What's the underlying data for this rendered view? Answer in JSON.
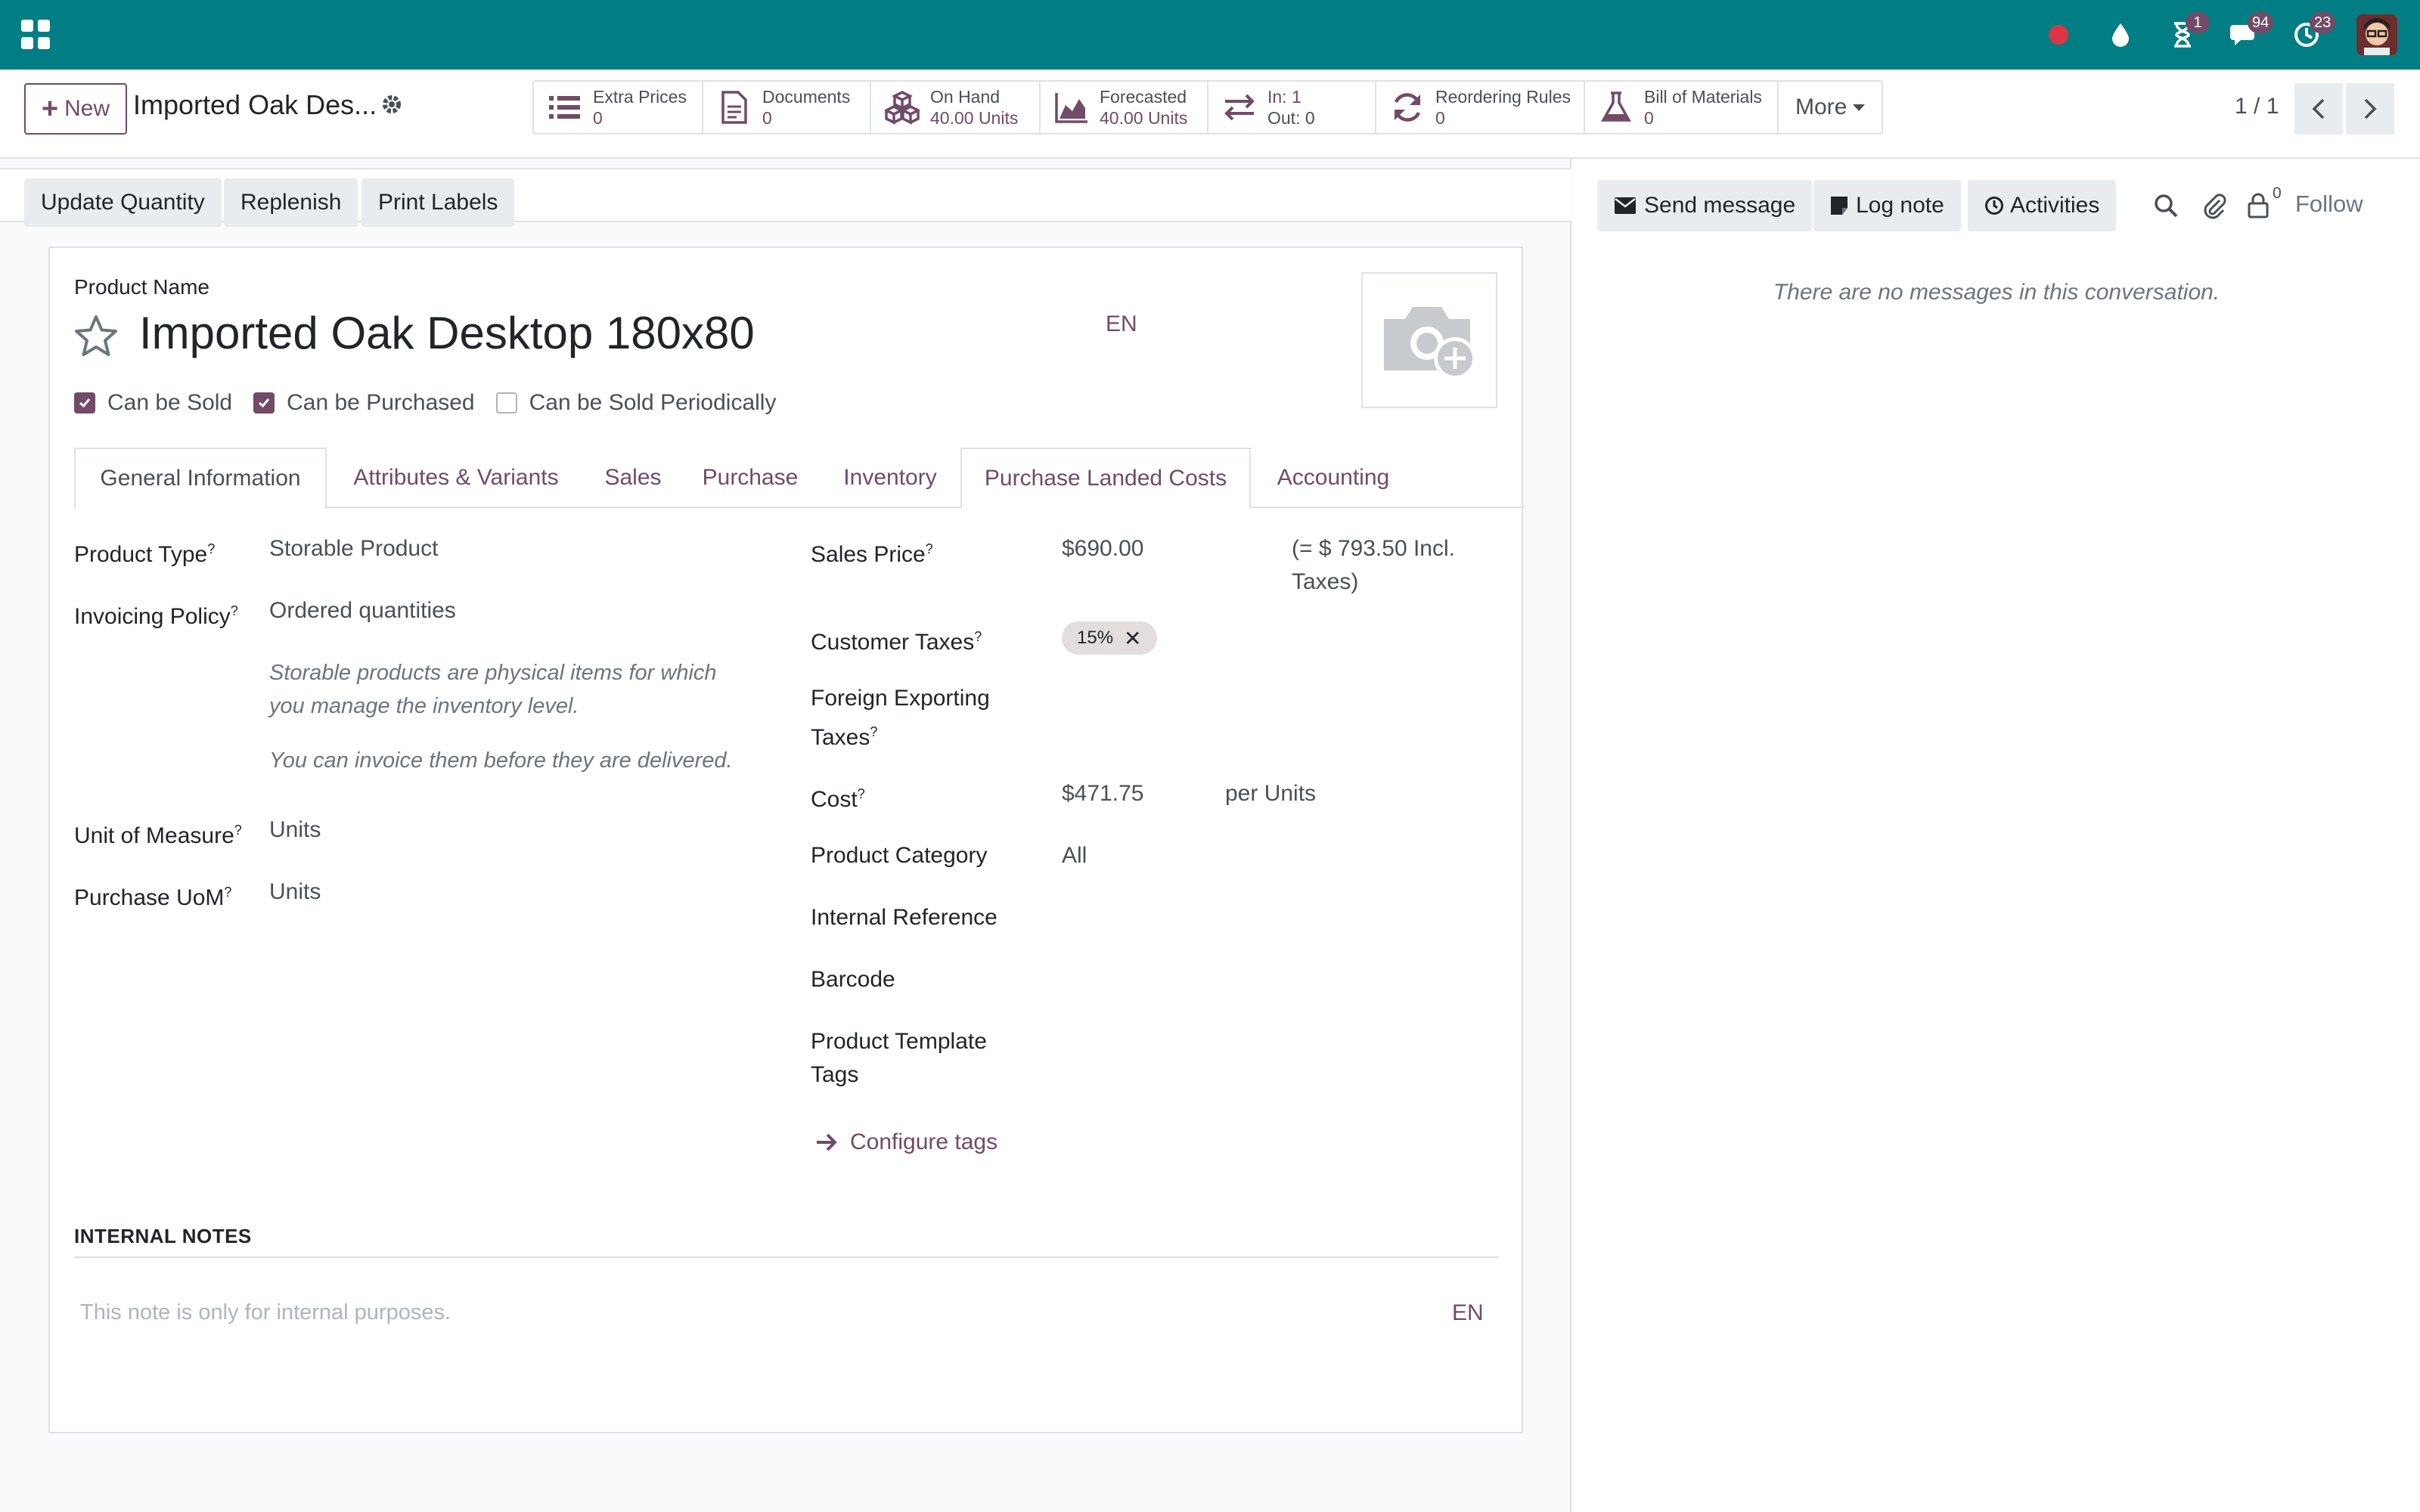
{
  "navbar": {
    "badges": {
      "activities": "1",
      "messages": "94",
      "clock": "23"
    }
  },
  "control": {
    "new_label": "New",
    "breadcrumb_title": "Imported Oak Des...",
    "smart_buttons": [
      {
        "label": "Extra Prices",
        "value": "0"
      },
      {
        "label": "Documents",
        "value": "0"
      },
      {
        "label": "On Hand",
        "value": "40.00 Units"
      },
      {
        "label": "Forecasted",
        "value": "40.00 Units"
      },
      {
        "label": "In: 1",
        "value": "Out: 0"
      },
      {
        "label": "Reordering Rules",
        "value": "0"
      },
      {
        "label": "Bill of Materials",
        "value": "0"
      }
    ],
    "more_label": "More",
    "pager": "1 / 1"
  },
  "header_buttons": {
    "update_quantity": "Update Quantity",
    "replenish": "Replenish",
    "print_labels": "Print Labels"
  },
  "product": {
    "name_label": "Product Name",
    "name": "Imported Oak Desktop 180x80",
    "lang": "EN",
    "checks": [
      {
        "label": "Can be Sold",
        "checked": true
      },
      {
        "label": "Can be Purchased",
        "checked": true
      },
      {
        "label": "Can be Sold Periodically",
        "checked": false
      }
    ]
  },
  "tabs": [
    "General Information",
    "Attributes & Variants",
    "Sales",
    "Purchase",
    "Inventory",
    "Purchase Landed Costs",
    "Accounting"
  ],
  "general": {
    "product_type_label": "Product Type",
    "product_type": "Storable Product",
    "invoicing_policy_label": "Invoicing Policy",
    "invoicing_policy": "Ordered quantities",
    "help_1a": "Storable products are physical items for which",
    "help_1b": "you manage the inventory level.",
    "help_2": "You can invoice them before they are delivered.",
    "uom_label": "Unit of Measure",
    "uom": "Units",
    "purchase_uom_label": "Purchase UoM",
    "purchase_uom": "Units",
    "sales_price_label": "Sales Price",
    "sales_price": "$690.00",
    "incl_taxes_a": "(= $ 793.50 Incl.",
    "incl_taxes_b": "Taxes)",
    "customer_taxes_label": "Customer Taxes",
    "customer_tax_tag": "15%",
    "foreign_taxes_label_a": "Foreign Exporting",
    "foreign_taxes_label_b": "Taxes",
    "cost_label": "Cost",
    "cost": "$471.75",
    "cost_unit": "per Units",
    "category_label": "Product Category",
    "category": "All",
    "internal_ref_label": "Internal Reference",
    "barcode_label": "Barcode",
    "template_tags_label_a": "Product Template",
    "template_tags_label_b": "Tags",
    "configure_tags": "Configure tags"
  },
  "notes": {
    "heading": "INTERNAL NOTES",
    "placeholder": "This note is only for internal purposes.",
    "lang": "EN"
  },
  "chatter": {
    "send_message": "Send message",
    "log_note": "Log note",
    "activities": "Activities",
    "followers_count": "0",
    "follow": "Follow",
    "empty": "There are no messages in this conversation."
  },
  "colors": {
    "navbar": "#017e84",
    "accent": "#714b67"
  }
}
